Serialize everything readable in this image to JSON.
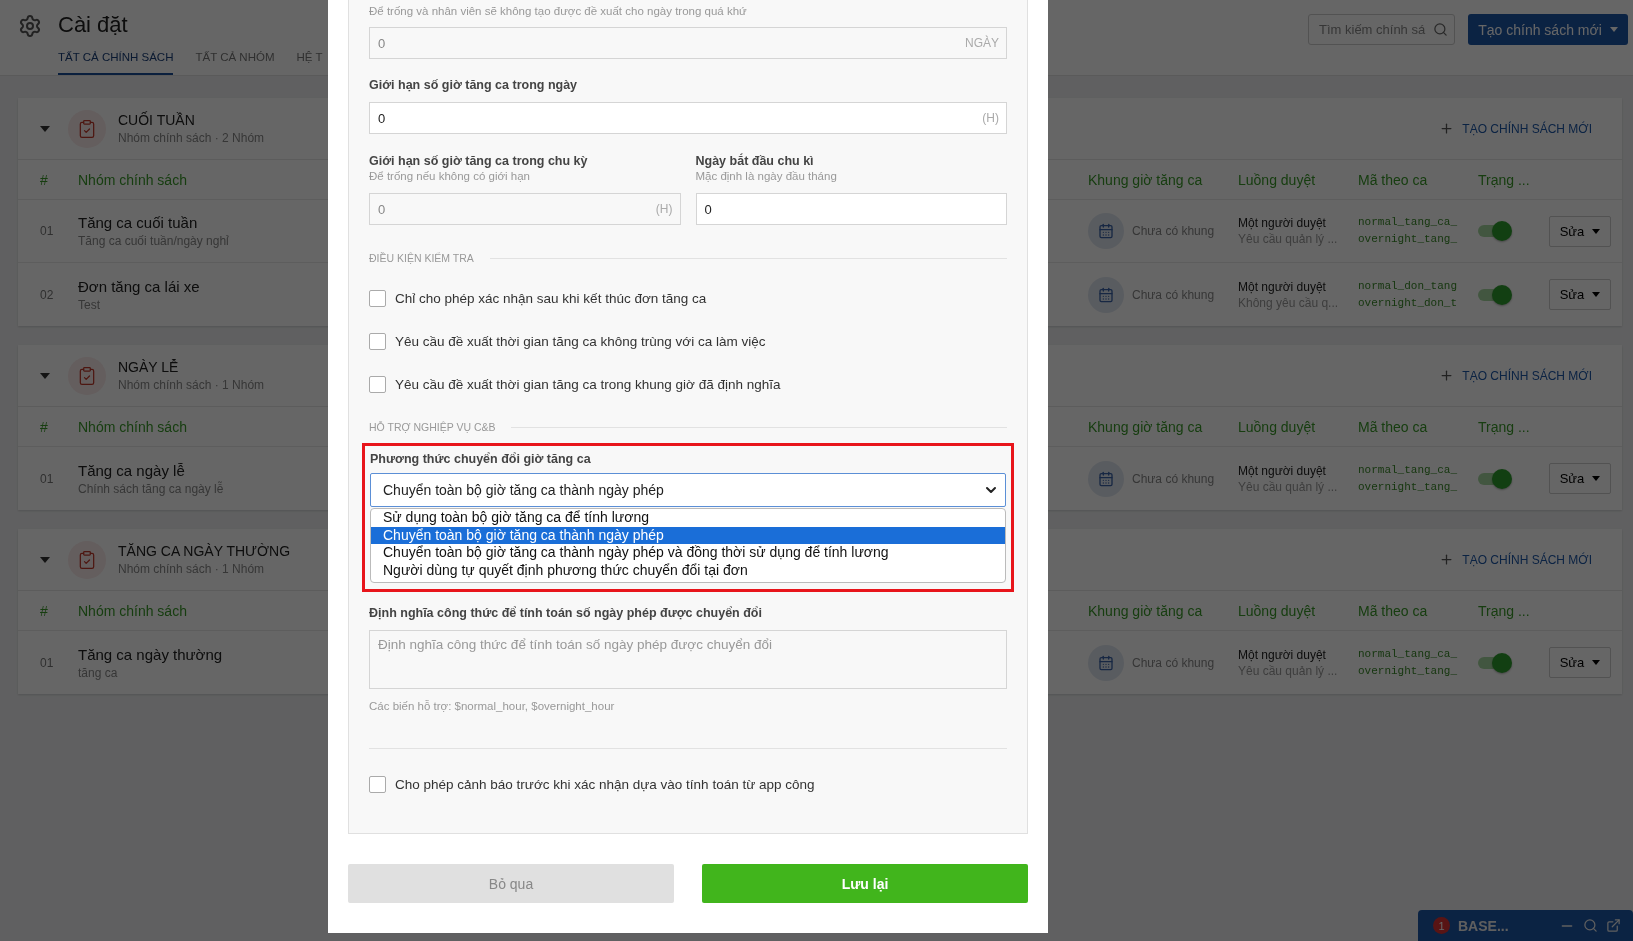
{
  "header": {
    "title": "Cài đặt",
    "tabs": [
      {
        "label": "TẤT CẢ CHÍNH SÁCH",
        "selected": true
      },
      {
        "label": "TẤT CẢ NHÓM",
        "selected": false
      },
      {
        "label": "HỆ T",
        "selected": false
      }
    ],
    "search": {
      "placeholder": "Tìm kiếm chính sá"
    },
    "create_button": "Tạo chính sách mới"
  },
  "groups": [
    {
      "title": "CUỐI TUẦN",
      "subtitle": "Nhóm chính sách · 2 Nhóm",
      "expanded": true,
      "add_link": "TẠO CHÍNH SÁCH MỚI",
      "columns": [
        "#",
        "Nhóm chính sách",
        "Khung giờ tăng ca",
        "Luồng duyệt",
        "Mã theo ca",
        "Trạng ..."
      ],
      "rows": [
        {
          "index": "01",
          "name": "Tăng ca cuối tuần",
          "description": "Tăng ca cuối tuần/ngày nghỉ",
          "time_frame": "Chưa có khung",
          "approval": "Một người duyệt",
          "approval_note": "Yêu cầu quản lý ...",
          "codes": [
            "normal_tang_ca_",
            "overnight_tang_"
          ],
          "active": true,
          "action": "Sửa"
        },
        {
          "index": "02",
          "name": "Đơn tăng ca lái xe",
          "description": "Test",
          "time_frame": "Chưa có khung",
          "approval": "Một người duyệt",
          "approval_note": "Không yêu cầu q...",
          "codes": [
            "normal_don_tang",
            "overnight_don_t"
          ],
          "active": true,
          "action": "Sửa"
        }
      ]
    },
    {
      "title": "NGÀY LỄ",
      "subtitle": "Nhóm chính sách · 1 Nhóm",
      "expanded": true,
      "add_link": "TẠO CHÍNH SÁCH MỚI",
      "columns": [
        "#",
        "Nhóm chính sách",
        "Khung giờ tăng ca",
        "Luồng duyệt",
        "Mã theo ca",
        "Trạng ..."
      ],
      "rows": [
        {
          "index": "01",
          "name": "Tăng ca ngày lễ",
          "description": "Chính sách tăng ca ngày lễ",
          "time_frame": "Chưa có khung",
          "approval": "Một người duyệt",
          "approval_note": "Yêu cầu quản lý ...",
          "codes": [
            "normal_tang_ca_",
            "overnight_tang_"
          ],
          "active": true,
          "action": "Sửa"
        }
      ]
    },
    {
      "title": "TĂNG CA NGÀY THƯỜNG",
      "subtitle": "Nhóm chính sách · 1 Nhóm",
      "expanded": true,
      "add_link": "TẠO CHÍNH SÁCH MỚI",
      "columns": [
        "#",
        "Nhóm chính sách",
        "Khung giờ tăng ca",
        "Luồng duyệt",
        "Mã theo ca",
        "Trạng ..."
      ],
      "rows": [
        {
          "index": "01",
          "name": "Tăng ca ngày thường",
          "description": "tăng ca",
          "time_frame": "Chưa có khung",
          "approval": "Một người duyệt",
          "approval_note": "Yêu cầu quản lý ...",
          "codes": [
            "normal_tang_ca_",
            "overnight_tang_"
          ],
          "active": true,
          "action": "Sửa"
        }
      ]
    }
  ],
  "chat_widget": {
    "badge": "1",
    "title": "BASE..."
  },
  "modal": {
    "past_days": {
      "hint": "Để trống và nhân viên sẽ không tạo được đề xuất cho ngày trong quá khứ",
      "placeholder": "0",
      "unit": "NGÀY"
    },
    "daily_limit": {
      "label": "Giới hạn số giờ tăng ca trong ngày",
      "value": "0",
      "unit": "(H)"
    },
    "cycle_limit": {
      "label": "Giới hạn số giờ tăng ca trong chu kỳ",
      "hint": "Để trống nếu không có giới hạn",
      "placeholder": "0",
      "unit": "(H)"
    },
    "cycle_start": {
      "label": "Ngày bắt đầu chu kì",
      "hint": "Mặc định là ngày đầu tháng",
      "value": "0"
    },
    "check_section": {
      "title": "ĐIỀU KIỆN KIỂM TRA",
      "options": [
        {
          "label": "Chỉ cho phép xác nhận sau khi kết thúc đơn tăng ca",
          "checked": false
        },
        {
          "label": "Yêu cầu đề xuất thời gian tăng ca không trùng với ca làm việc",
          "checked": false
        },
        {
          "label": "Yêu cầu đề xuất thời gian tăng ca trong khung giờ đã định nghĩa",
          "checked": false
        }
      ]
    },
    "cb_section": {
      "title": "HỖ TRỢ NGHIỆP VỤ C&B",
      "conversion": {
        "label": "Phương thức chuyển đổi giờ tăng ca",
        "value": "Chuyển toàn bộ giờ tăng ca thành ngày phép",
        "expanded": true,
        "options": [
          {
            "label": "Sử dụng toàn bộ giờ tăng ca để tính lương",
            "selected": false
          },
          {
            "label": "Chuyển toàn bộ giờ tăng ca thành ngày phép",
            "selected": true
          },
          {
            "label": "Chuyển toàn bộ giờ tăng ca thành ngày phép và đồng thời sử dụng để tính lương",
            "selected": false
          },
          {
            "label": "Người dùng tự quyết định phương thức chuyển đổi tại đơn",
            "selected": false
          }
        ]
      },
      "formula": {
        "label": "Định nghĩa công thức để tính toán số ngày phép được chuyển đổi",
        "placeholder": "Định nghĩa công thức để tính toán số ngày phép được chuyển đổi",
        "hint": "Các biến hỗ trợ: $normal_hour, $overnight_hour"
      }
    },
    "warning_option": {
      "label": "Cho phép cảnh báo trước khi xác nhận dựa vào tính toán từ app công",
      "checked": false
    },
    "buttons": {
      "cancel": "Bỏ qua",
      "save": "Lưu lại"
    }
  }
}
